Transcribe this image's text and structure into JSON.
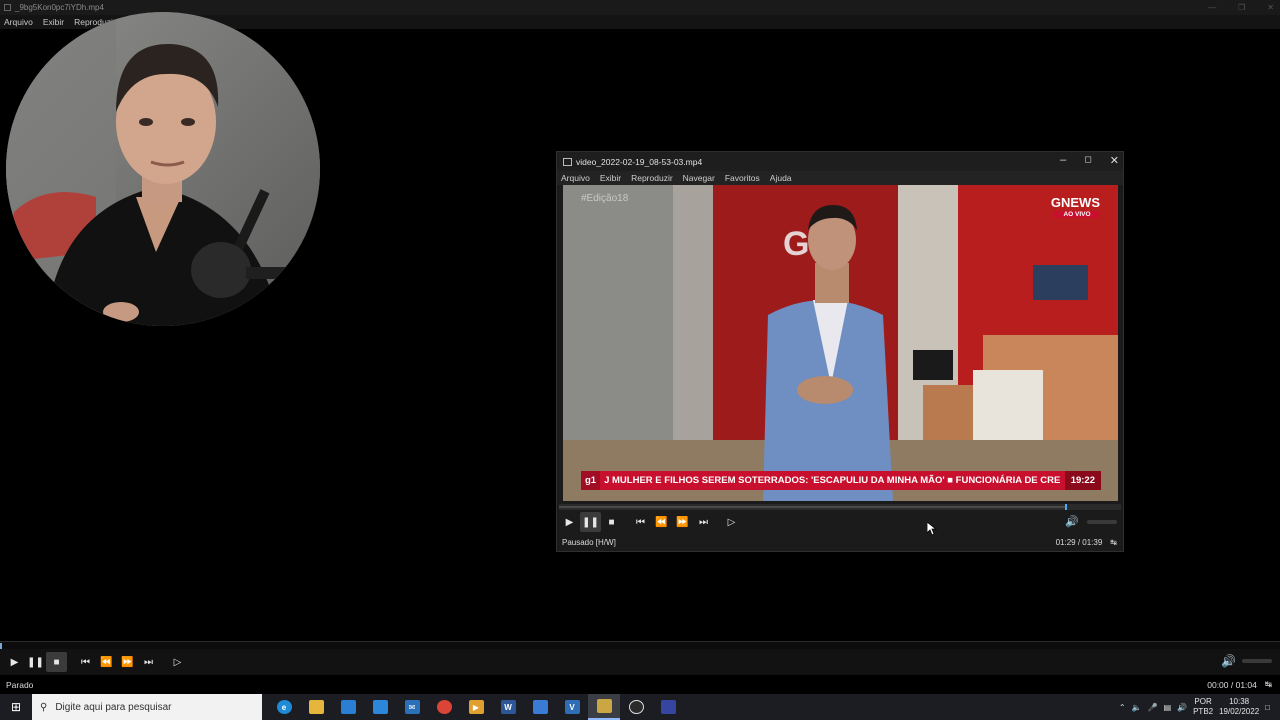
{
  "outer_window": {
    "title": "_9bg5Kon0pc7iYDh.mp4",
    "menu": [
      "Arquivo",
      "Exibir",
      "Reproduzir"
    ],
    "status": "Parado",
    "time": "00:00 / 01:04"
  },
  "inner_window": {
    "title": "video_2022-02-19_08-53-03.mp4",
    "menu": [
      "Arquivo",
      "Exibir",
      "Reproduzir",
      "Navegar",
      "Favoritos",
      "Ajuda"
    ],
    "status": "Pausado [H/W]",
    "time": "01:29 / 01:39",
    "progress_fraction": 0.9
  },
  "broadcast": {
    "watermark": "#Edição18",
    "channel": "GNEWS",
    "live_label": "AO VIVO",
    "ticker_brand": "g1",
    "ticker_text": "J MULHER E FILHOS SEREM SOTERRADOS: 'ESCAPULIU DA MINHA MÃO'  ■  FUNCIONÁRIA DE CRE",
    "clock": "19:22"
  },
  "taskbar": {
    "search_placeholder": "Digite aqui para pesquisar",
    "tray_lang_top": "POR",
    "tray_lang_bottom": "PTB2",
    "tray_time": "10:38",
    "tray_date": "19/02/2022"
  },
  "colors": {
    "accent": "#4ea8ff",
    "ticker_red": "#c8102e"
  }
}
